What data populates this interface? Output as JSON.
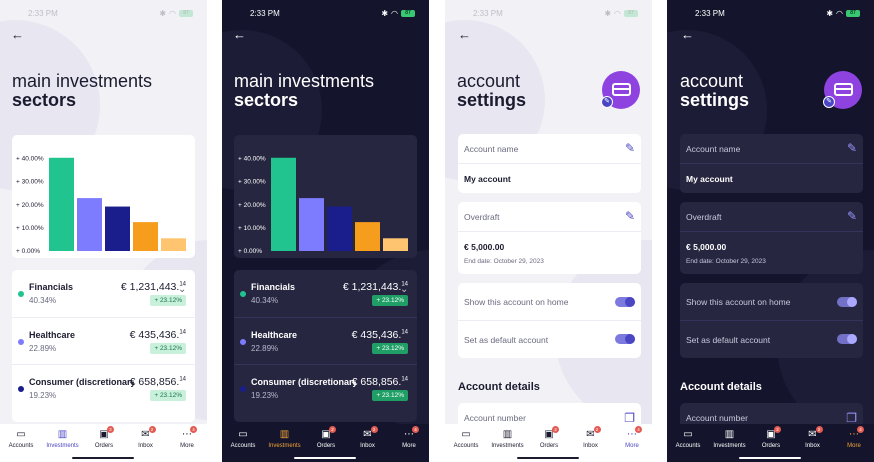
{
  "status": {
    "time": "2:33 PM",
    "battery": "87"
  },
  "colors": {
    "accent": "#4b46c3",
    "dark_active": "#f1a334",
    "badge": "#1f9f66",
    "avatar": "#8e43e0"
  },
  "investments": {
    "title_line1": "main investments",
    "title_line2": "sectors",
    "chart_data": {
      "type": "bar",
      "categories": [
        "Financials",
        "Healthcare",
        "Consumer (discretionary)",
        "",
        ""
      ],
      "values": [
        40.34,
        22.89,
        19.23,
        12.5,
        5.5
      ],
      "colors": [
        "#21c48e",
        "#7d7cff",
        "#1a1d8c",
        "#f79d1e",
        "#ffc46f"
      ],
      "yticks": [
        "+ 0.00%",
        "+ 10.00%",
        "+ 20.00%",
        "+ 30.00%",
        "+ 40.00%"
      ],
      "ylim": [
        0,
        45
      ],
      "grid": false,
      "legend": "none"
    },
    "rows": [
      {
        "name": "Financials",
        "pct": "40.34%",
        "amount": "€ 1,231,443.",
        "cents": "14",
        "badge": "+ 23.12%",
        "color": "#21c48e"
      },
      {
        "name": "Healthcare",
        "pct": "22.89%",
        "amount": "€ 435,436.",
        "cents": "14",
        "badge": "+ 23.12%",
        "color": "#7d7cff"
      },
      {
        "name": "Consumer (discretionary)",
        "pct": "19.23%",
        "amount": "€ 658,856.",
        "cents": "14",
        "badge": "+ 23.12%",
        "color": "#1a1d8c"
      }
    ]
  },
  "account": {
    "title_line1": "account",
    "title_line2": "settings",
    "name_label": "Account name",
    "name_value": "My account",
    "overdraft_label": "Overdraft",
    "overdraft_value": "€ 5,000.00",
    "overdraft_end": "End date: October 29, 2023",
    "toggle_home": "Show this account on home",
    "toggle_default": "Set as default account",
    "details_header": "Account details",
    "number_label": "Account number"
  },
  "tabs": [
    {
      "label": "Accounts",
      "icon": "card-icon",
      "badge": ""
    },
    {
      "label": "Investments",
      "icon": "chart-icon",
      "badge": ""
    },
    {
      "label": "Orders",
      "icon": "briefcase-icon",
      "badge": "2"
    },
    {
      "label": "Inbox",
      "icon": "mail-icon",
      "badge": "2"
    },
    {
      "label": "More",
      "icon": "more-icon",
      "badge": "4"
    }
  ]
}
